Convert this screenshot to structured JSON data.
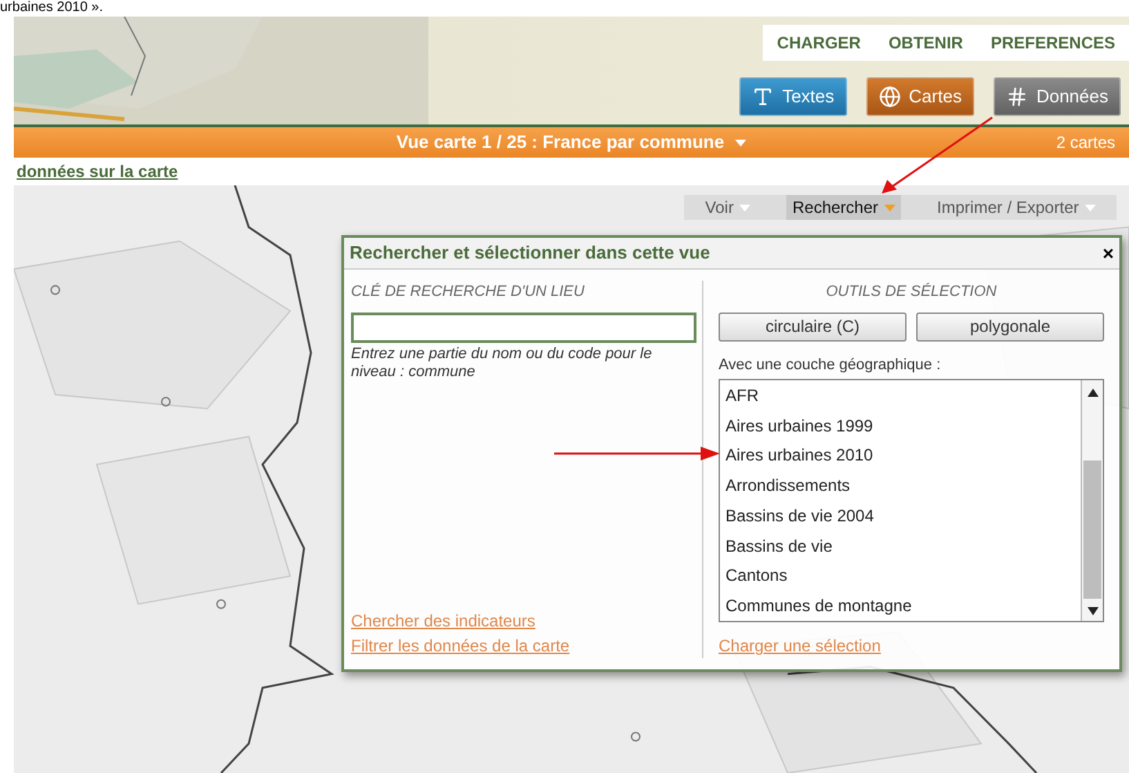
{
  "document_text": "urbaines 2010 ».",
  "header": {
    "nav_links": [
      "CHARGER",
      "OBTENIR",
      "PREFERENCES"
    ],
    "mode_buttons": [
      {
        "label": "Textes",
        "kind": "textes"
      },
      {
        "label": "Cartes",
        "kind": "cartes"
      },
      {
        "label": "Données",
        "kind": "donnees"
      }
    ]
  },
  "view_bar": {
    "title": "Vue carte 1 / 25 : France par commune",
    "count": "2 cartes"
  },
  "data_link": "données sur la carte",
  "map_toolbar": [
    {
      "label": "Voir",
      "selected": false
    },
    {
      "label": "Rechercher",
      "selected": true
    },
    {
      "label": "Imprimer / Exporter",
      "selected": false
    }
  ],
  "dialog": {
    "title": "Rechercher et sélectionner dans cette vue",
    "close": "×",
    "search": {
      "heading": "CLÉ DE RECHERCHE D'UN LIEU",
      "help": "Entrez une partie du nom ou du code pour le niveau : commune",
      "links": [
        "Chercher des indicateurs",
        "Filtrer les données de la carte"
      ]
    },
    "tools": {
      "heading": "OUTILS DE SÉLECTION",
      "buttons": [
        "circulaire (C)",
        "polygonale"
      ],
      "layer_label": "Avec une couche géographique :",
      "layers": [
        "AFR",
        "Aires urbaines 1999",
        "Aires urbaines 2010",
        "Arrondissements",
        "Bassins de vie 2004",
        "Bassins de vie",
        "Cantons",
        "Communes de montagne"
      ],
      "link": "Charger une sélection"
    }
  }
}
